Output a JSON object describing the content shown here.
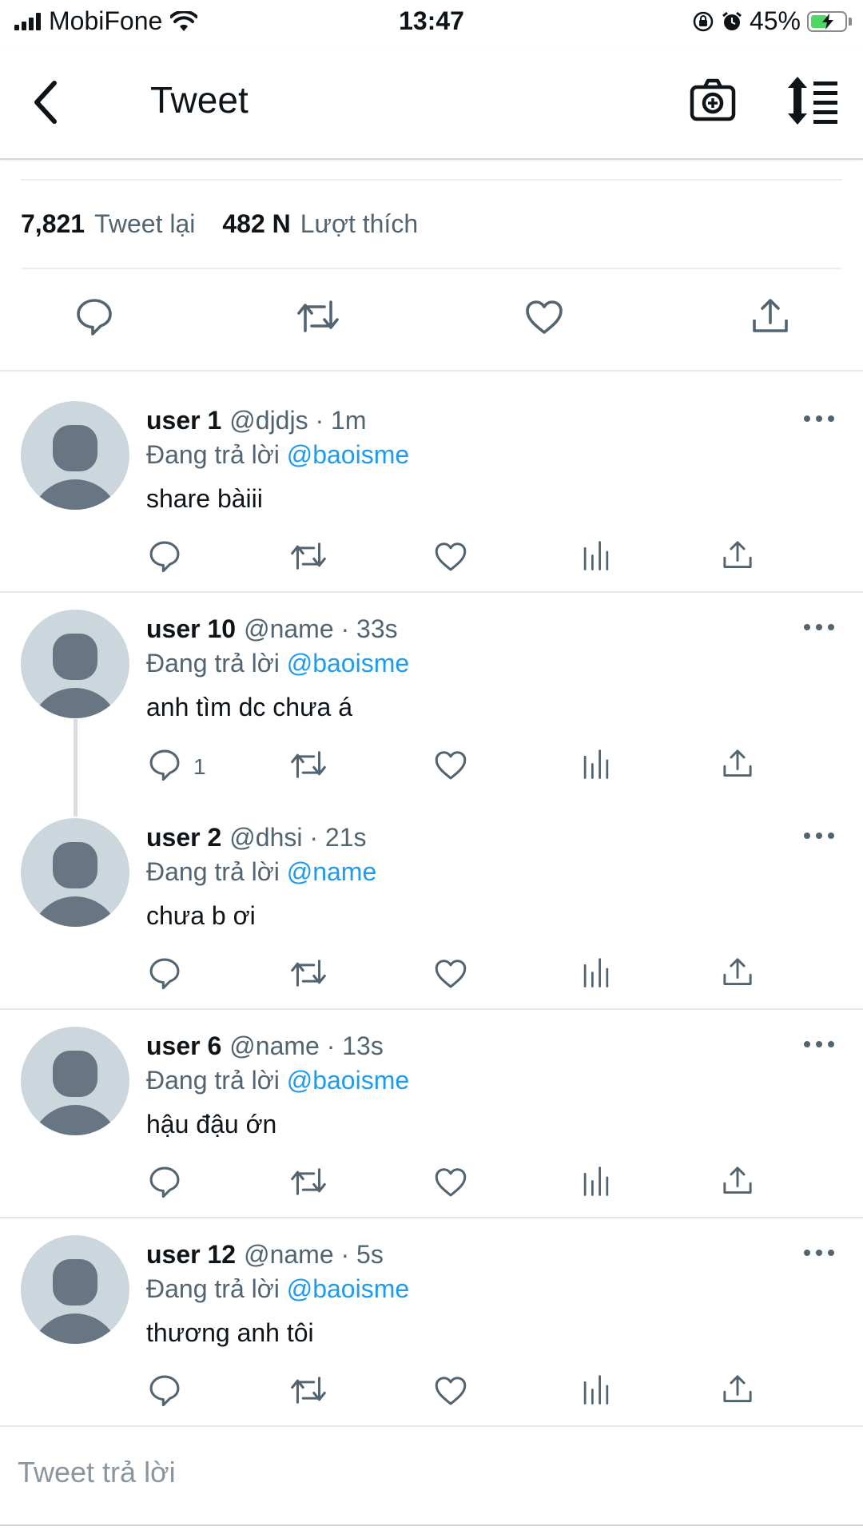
{
  "status_bar": {
    "carrier": "MobiFone",
    "time": "13:47",
    "battery": "45%",
    "battery_level": 0.45
  },
  "header": {
    "title": "Tweet"
  },
  "stats": {
    "retweets_count": "7,821",
    "retweets_label": "Tweet lại",
    "likes_count": "482 N",
    "likes_label": "Lượt thích"
  },
  "replies": [
    {
      "name": "user 1",
      "handle_time": "@djdjs · 1m",
      "reply_prefix": "Đang trả lời",
      "reply_to": "@baoisme",
      "text": "share bàiii",
      "reply_count": ""
    },
    {
      "name": "user 10",
      "handle_time": "@name · 33s",
      "reply_prefix": "Đang trả lời",
      "reply_to": "@baoisme",
      "text": "anh tìm dc chưa á",
      "reply_count": "1"
    },
    {
      "name": "user 2",
      "handle_time": "@dhsi · 21s",
      "reply_prefix": "Đang trả lời",
      "reply_to": "@name",
      "text": "chưa b ơi",
      "reply_count": ""
    },
    {
      "name": "user 6",
      "handle_time": "@name · 13s",
      "reply_prefix": "Đang trả lời",
      "reply_to": "@baoisme",
      "text": "hậu đậu ớn",
      "reply_count": ""
    },
    {
      "name": "user 12",
      "handle_time": "@name · 5s",
      "reply_prefix": "Đang trả lời",
      "reply_to": "@baoisme",
      "text": "thương anh tôi",
      "reply_count": ""
    }
  ],
  "reply_box": {
    "placeholder": "Tweet trả lời"
  },
  "colors": {
    "text": "#0f1419",
    "secondary": "#536471",
    "mention": "#1d9bf0",
    "avatar_bg": "#ccd6dd",
    "avatar_fg": "#687684",
    "battery_fill": "#4cd964"
  }
}
